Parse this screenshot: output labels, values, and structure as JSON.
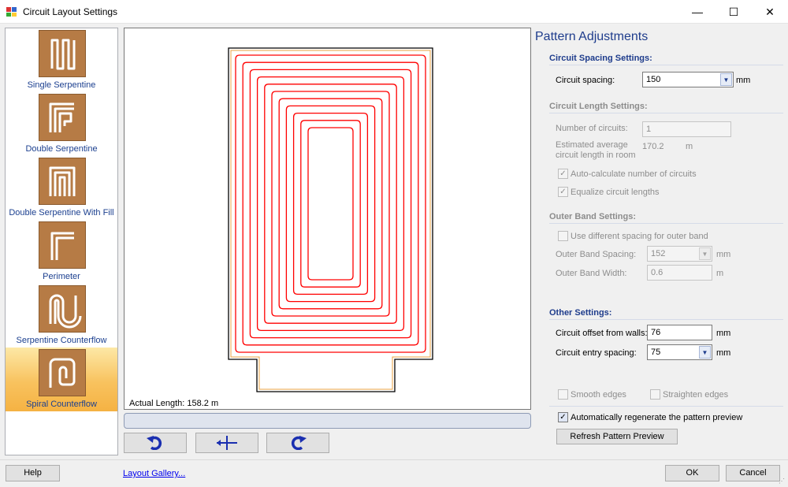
{
  "window": {
    "title": "Circuit Layout Settings",
    "min_icon": "minimize-icon",
    "max_icon": "maximize-icon",
    "close_icon": "close-icon"
  },
  "sidebar": {
    "items": [
      {
        "label": "Single Serpentine",
        "icon": "single-serpentine-icon"
      },
      {
        "label": "Double Serpentine",
        "icon": "double-serpentine-icon"
      },
      {
        "label": "Double Serpentine With Fill",
        "icon": "double-serpentine-fill-icon"
      },
      {
        "label": "Perimeter",
        "icon": "perimeter-icon"
      },
      {
        "label": "Serpentine Counterflow",
        "icon": "serpentine-counterflow-icon"
      },
      {
        "label": "Spiral Counterflow",
        "icon": "spiral-counterflow-icon",
        "selected": true
      }
    ]
  },
  "preview": {
    "actual_length": "Actual Length: 158.2 m",
    "wall_color": "#000000",
    "band_color": "#e8a040",
    "pipe_color": "#ff0000"
  },
  "toolbar": {
    "rotate_left_icon": "rotate-left-icon",
    "split_icon": "split-icon",
    "rotate_right_icon": "rotate-right-icon"
  },
  "pane": {
    "title": "Pattern Adjustments",
    "spacing": {
      "heading": "Circuit Spacing Settings:",
      "label": "Circuit spacing:",
      "value": "150",
      "unit": "mm"
    },
    "length": {
      "heading": "Circuit Length Settings:",
      "num_label": "Number of circuits:",
      "num_value": "1",
      "est_label_1": "Estimated average",
      "est_label_2": "circuit length in room",
      "est_value": "170.2",
      "est_unit": "m",
      "auto_calc_label": "Auto-calculate number of circuits",
      "equalize_label": "Equalize circuit lengths"
    },
    "outer": {
      "heading": "Outer Band Settings:",
      "diff_label": "Use different spacing for outer band",
      "spacing_label": "Outer Band Spacing:",
      "spacing_value": "152",
      "spacing_unit": "mm",
      "width_label": "Outer Band Width:",
      "width_value": "0.6",
      "width_unit": "m"
    },
    "other": {
      "heading": "Other Settings:",
      "offset_label": "Circuit offset from walls:",
      "offset_value": "76",
      "offset_unit": "mm",
      "entry_label": "Circuit entry spacing:",
      "entry_value": "75",
      "entry_unit": "mm"
    },
    "smooth_label": "Smooth edges",
    "straighten_label": "Straighten edges",
    "auto_regen_label": "Automatically regenerate the pattern preview",
    "refresh_label": "Refresh Pattern Preview"
  },
  "footer": {
    "help": "Help",
    "gallery": "Layout Gallery...",
    "ok": "OK",
    "cancel": "Cancel"
  },
  "checks": {
    "on": "✓",
    "off": ""
  },
  "colors": {
    "accent": "#1e3c8c",
    "selected_item": "#f8c25e",
    "tile": "#b67b45"
  }
}
